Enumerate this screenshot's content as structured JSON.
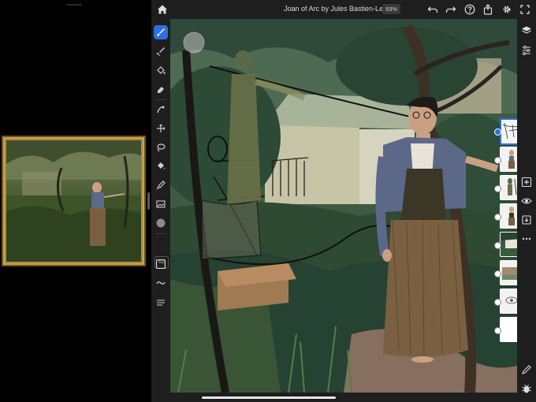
{
  "document": {
    "title": "Joan of Arc by Jules Bastien-Lepage",
    "zoom": "93%"
  },
  "toolbar": {
    "brush_size": "62",
    "tools": [
      "paint-brush",
      "pixel-brush",
      "fill",
      "eraser",
      "smudge",
      "move",
      "lasso",
      "paint-bucket",
      "eyedropper",
      "image-import",
      "color-swatch"
    ]
  },
  "top_actions": [
    "undo",
    "redo",
    "help",
    "share",
    "settings",
    "fullscreen"
  ],
  "right_actions": [
    "layers",
    "layer-properties",
    "add-layer",
    "visibility",
    "merge-down",
    "more-options",
    "touch-shortcut",
    "bug-report"
  ],
  "layers": {
    "count": 8,
    "active_index": 0
  },
  "colors": {
    "accent": "#2d6fe0",
    "ui_background": "#1e1e1e"
  }
}
